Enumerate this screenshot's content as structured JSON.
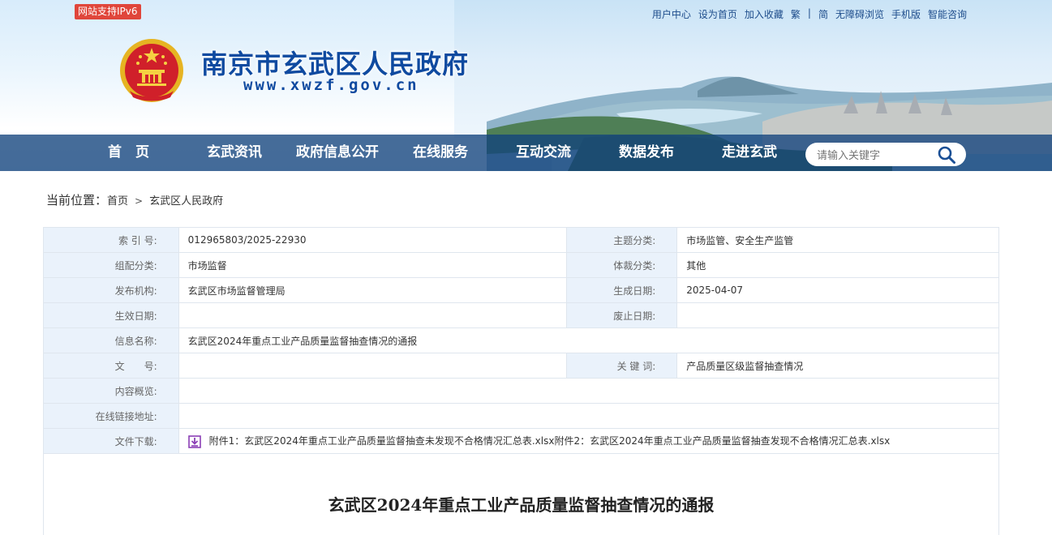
{
  "header": {
    "ipv6_badge": "网站支持IPv6",
    "top_links": [
      "用户中心",
      "设为首页",
      "加入收藏",
      "繁",
      "|",
      "简",
      "无障碍浏览",
      "手机版",
      "智能咨询"
    ],
    "site_title": "南京市玄武区人民政府",
    "site_url": "www.xwzf.gov.cn"
  },
  "nav": {
    "items": [
      "首　页",
      "玄武资讯",
      "政府信息公开",
      "在线服务",
      "互动交流",
      "数据发布",
      "走进玄武"
    ],
    "search_placeholder": "请输入关键字"
  },
  "breadcrumb": {
    "label": "当前位置：",
    "home": "首页",
    "current": "玄武区人民政府"
  },
  "meta": {
    "index_label": "索 引 号:",
    "index_value": "012965803/2025-22930",
    "topic_label": "主题分类:",
    "topic_value": "市场监管、安全生产监管",
    "org_cat_label": "组配分类:",
    "org_cat_value": "市场监督",
    "genre_label": "体裁分类:",
    "genre_value": "其他",
    "publisher_label": "发布机构:",
    "publisher_value": "玄武区市场监督管理局",
    "created_label": "生成日期:",
    "created_value": "2025-04-07",
    "effective_label": "生效日期:",
    "effective_value": "",
    "expire_label": "废止日期:",
    "expire_value": "",
    "name_label": "信息名称:",
    "name_value": "玄武区2024年重点工业产品质量监督抽查情况的通报",
    "docno_label": "文　　号:",
    "docno_value": "",
    "keywords_label": "关 键 词:",
    "keywords_value": "产品质量区级监督抽查情况",
    "summary_label": "内容概览:",
    "summary_value": "",
    "link_label": "在线链接地址:",
    "link_value": "",
    "download_label": "文件下载:",
    "download_value": "附件1：玄武区2024年重点工业产品质量监督抽查未发现不合格情况汇总表.xlsx附件2：玄武区2024年重点工业产品质量监督抽查发现不合格情况汇总表.xlsx"
  },
  "article": {
    "title": "玄武区2024年重点工业产品质量监督抽查情况的通报"
  },
  "colors": {
    "nav_bg": "#12427c",
    "title_blue": "#0f4aa0",
    "ipv6_red": "#e0463b",
    "label_bg": "#eaf2fb",
    "border": "#dfe6ee"
  }
}
